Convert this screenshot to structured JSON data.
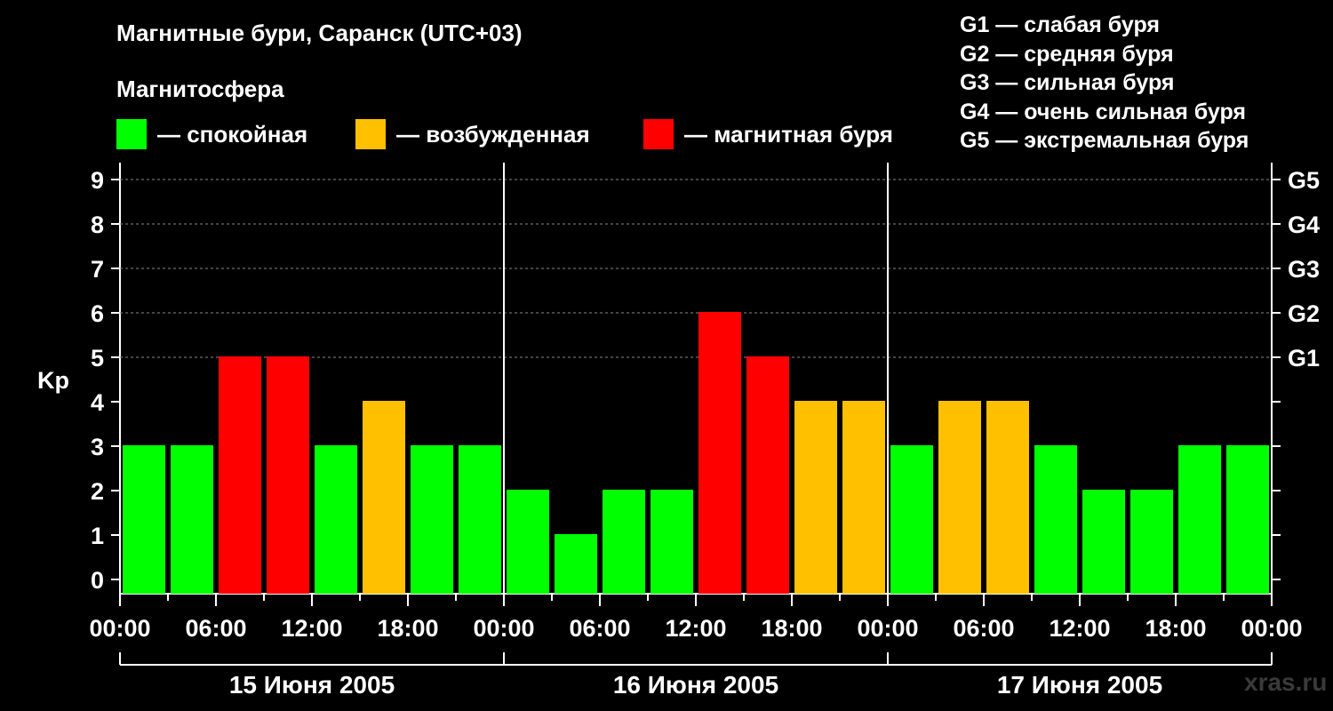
{
  "title": "Магнитные бури, Саранск (UTC+03)",
  "subtitle": "Магнитосфера",
  "colors": {
    "calm": "#00ff00",
    "excited": "#ffc000",
    "storm": "#ff0000",
    "background": "#000000",
    "axis": "#ffffff",
    "watermark": "#3a3a3a"
  },
  "legend": [
    {
      "key": "calm",
      "label": "— спокойная"
    },
    {
      "key": "excited",
      "label": "— возбужденная"
    },
    {
      "key": "storm",
      "label": "— магнитная буря"
    }
  ],
  "g_legend": [
    "G1 — слабая буря",
    "G2 — средняя буря",
    "G3 — сильная буря",
    "G4 — очень сильная буря",
    "G5 — экстремальная буря"
  ],
  "watermark": "xras.ru",
  "chart_data": {
    "type": "bar",
    "ylabel": "Kp",
    "ylim": [
      0,
      9
    ],
    "y_ticks": [
      0,
      1,
      2,
      3,
      4,
      5,
      6,
      7,
      8,
      9
    ],
    "g_scale": [
      {
        "level": 5,
        "label": "G1"
      },
      {
        "level": 6,
        "label": "G2"
      },
      {
        "level": 7,
        "label": "G3"
      },
      {
        "level": 8,
        "label": "G4"
      },
      {
        "level": 9,
        "label": "G5"
      }
    ],
    "x_tick_labels": [
      "00:00",
      "06:00",
      "12:00",
      "18:00",
      "00:00",
      "06:00",
      "12:00",
      "18:00",
      "00:00",
      "06:00",
      "12:00",
      "18:00",
      "00:00"
    ],
    "days": [
      "15 Июня 2005",
      "16 Июня 2005",
      "17 Июня 2005"
    ],
    "grid": "dashed horizontal at integer Kp 5–9",
    "values": [
      3,
      3,
      5,
      5,
      3,
      4,
      3,
      3,
      2,
      1,
      2,
      2,
      6,
      5,
      4,
      4,
      3,
      4,
      4,
      3,
      2,
      2,
      3,
      3
    ],
    "categories": [
      "storm",
      "calm",
      "excited"
    ],
    "bar_status": [
      "calm",
      "calm",
      "storm",
      "storm",
      "calm",
      "excited",
      "calm",
      "calm",
      "calm",
      "calm",
      "calm",
      "calm",
      "storm",
      "storm",
      "excited",
      "excited",
      "calm",
      "excited",
      "excited",
      "calm",
      "calm",
      "calm",
      "calm",
      "calm"
    ]
  }
}
